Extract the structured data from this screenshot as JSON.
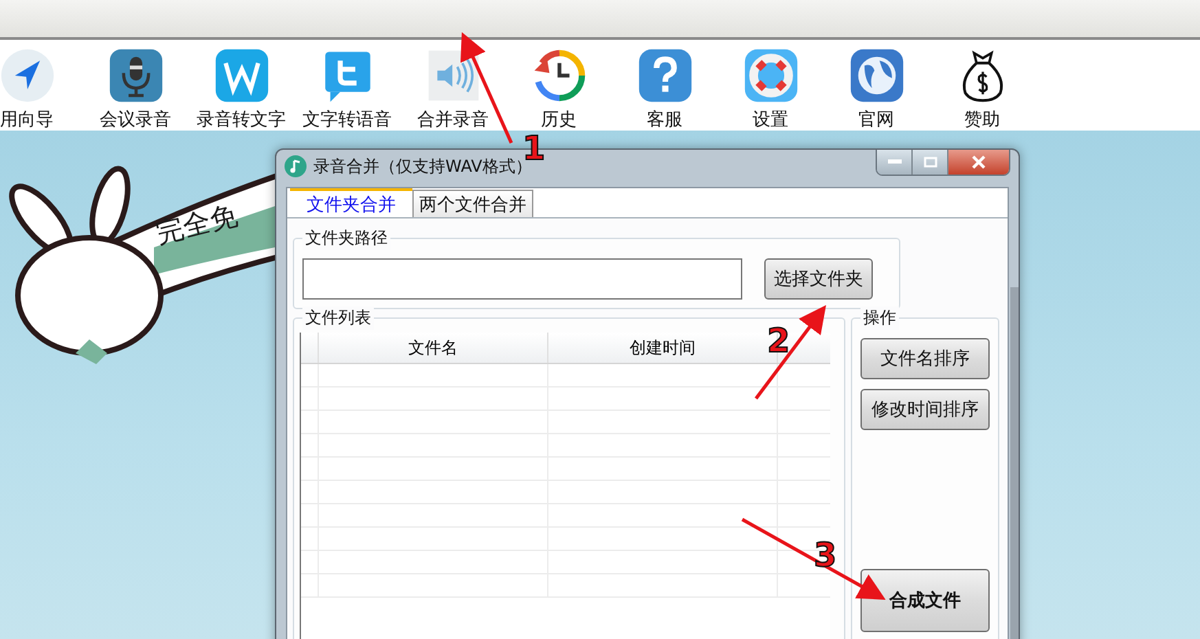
{
  "toolbar": {
    "items": [
      {
        "label": "用向导"
      },
      {
        "label": "会议录音"
      },
      {
        "label": "录音转文字"
      },
      {
        "label": "文字转语音"
      },
      {
        "label": "合并录音"
      },
      {
        "label": "历史"
      },
      {
        "label": "客服"
      },
      {
        "label": "设置"
      },
      {
        "label": "官网"
      },
      {
        "label": "赞助"
      }
    ]
  },
  "banner": {
    "text": "完全免"
  },
  "dialog": {
    "title": "录音合并（仅支持WAV格式）",
    "tabs": [
      {
        "label": "文件夹合并",
        "selected": true
      },
      {
        "label": "两个文件合并",
        "selected": false
      }
    ],
    "folder_group": {
      "label": "文件夹路径",
      "button": "选择文件夹"
    },
    "list_group": {
      "label": "文件列表",
      "columns": [
        "文件名",
        "创建时间"
      ]
    },
    "actions_group": {
      "label": "操作",
      "buttons": [
        "文件名排序",
        "修改时间排序"
      ],
      "primary_button": "合成文件"
    }
  },
  "annotations": [
    {
      "label": "1"
    },
    {
      "label": "2"
    },
    {
      "label": "3"
    }
  ]
}
